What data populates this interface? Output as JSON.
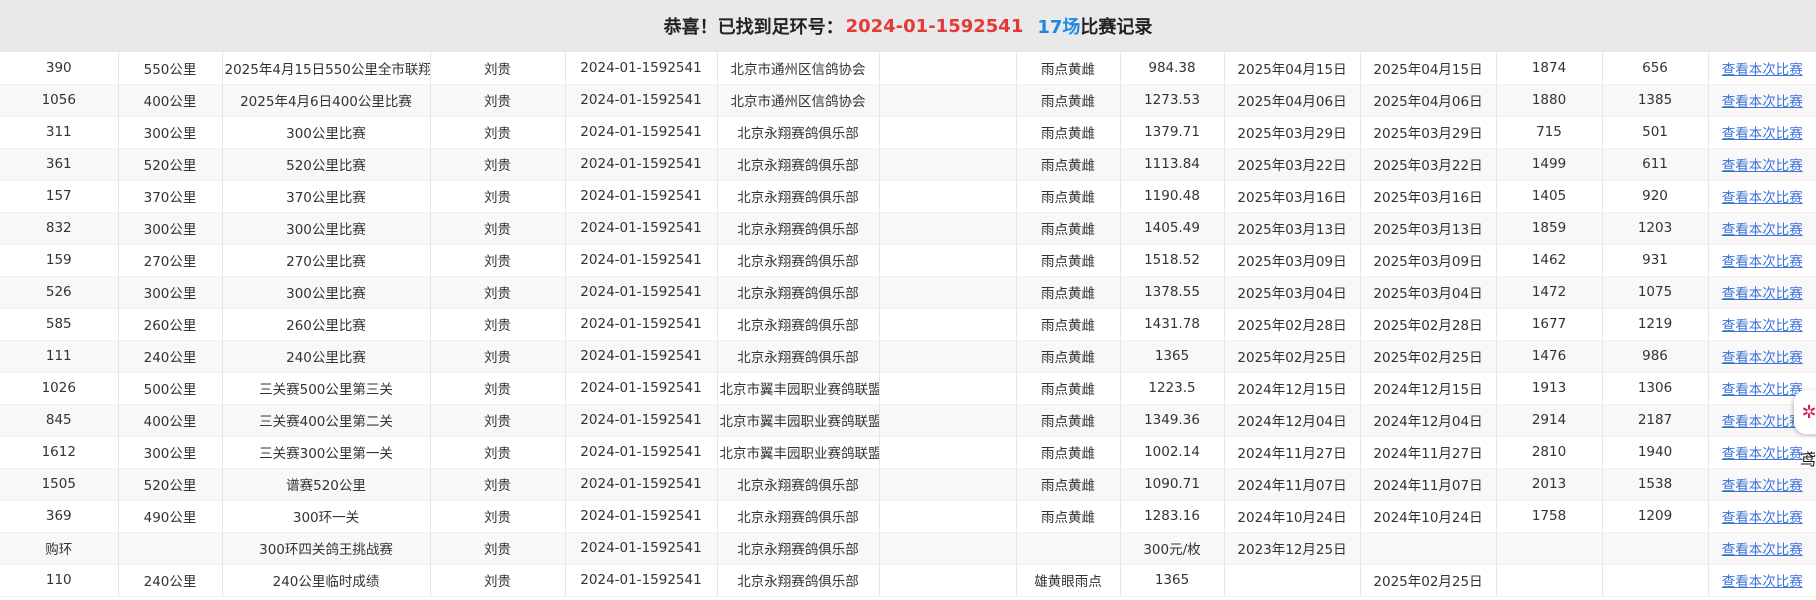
{
  "header": {
    "prefix": "恭喜！已找到足环号：",
    "ring_number": "2024-01-1592541",
    "count": "17场",
    "suffix": "比赛记录"
  },
  "rows": [
    {
      "rank": "390",
      "distance": "550公里",
      "race": "2025年4月15日550公里全市联翔",
      "owner": "刘贵",
      "ring": "2024-01-1592541",
      "org": "北京市通州区信鸽协会",
      "extra": "",
      "feather": "雨点黄雌",
      "speed": "984.38",
      "date1": "2025年04月15日",
      "date2": "2025年04月15日",
      "total": "1874",
      "basket": "656",
      "link": "查看本次比赛"
    },
    {
      "rank": "1056",
      "distance": "400公里",
      "race": "2025年4月6日400公里比赛",
      "owner": "刘贵",
      "ring": "2024-01-1592541",
      "org": "北京市通州区信鸽协会",
      "extra": "",
      "feather": "雨点黄雌",
      "speed": "1273.53",
      "date1": "2025年04月06日",
      "date2": "2025年04月06日",
      "total": "1880",
      "basket": "1385",
      "link": "查看本次比赛"
    },
    {
      "rank": "311",
      "distance": "300公里",
      "race": "300公里比赛",
      "owner": "刘贵",
      "ring": "2024-01-1592541",
      "org": "北京永翔赛鸽俱乐部",
      "extra": "",
      "feather": "雨点黄雌",
      "speed": "1379.71",
      "date1": "2025年03月29日",
      "date2": "2025年03月29日",
      "total": "715",
      "basket": "501",
      "link": "查看本次比赛"
    },
    {
      "rank": "361",
      "distance": "520公里",
      "race": "520公里比赛",
      "owner": "刘贵",
      "ring": "2024-01-1592541",
      "org": "北京永翔赛鸽俱乐部",
      "extra": "",
      "feather": "雨点黄雌",
      "speed": "1113.84",
      "date1": "2025年03月22日",
      "date2": "2025年03月22日",
      "total": "1499",
      "basket": "611",
      "link": "查看本次比赛"
    },
    {
      "rank": "157",
      "distance": "370公里",
      "race": "370公里比赛",
      "owner": "刘贵",
      "ring": "2024-01-1592541",
      "org": "北京永翔赛鸽俱乐部",
      "extra": "",
      "feather": "雨点黄雌",
      "speed": "1190.48",
      "date1": "2025年03月16日",
      "date2": "2025年03月16日",
      "total": "1405",
      "basket": "920",
      "link": "查看本次比赛"
    },
    {
      "rank": "832",
      "distance": "300公里",
      "race": "300公里比赛",
      "owner": "刘贵",
      "ring": "2024-01-1592541",
      "org": "北京永翔赛鸽俱乐部",
      "extra": "",
      "feather": "雨点黄雌",
      "speed": "1405.49",
      "date1": "2025年03月13日",
      "date2": "2025年03月13日",
      "total": "1859",
      "basket": "1203",
      "link": "查看本次比赛"
    },
    {
      "rank": "159",
      "distance": "270公里",
      "race": "270公里比赛",
      "owner": "刘贵",
      "ring": "2024-01-1592541",
      "org": "北京永翔赛鸽俱乐部",
      "extra": "",
      "feather": "雨点黄雌",
      "speed": "1518.52",
      "date1": "2025年03月09日",
      "date2": "2025年03月09日",
      "total": "1462",
      "basket": "931",
      "link": "查看本次比赛"
    },
    {
      "rank": "526",
      "distance": "300公里",
      "race": "300公里比赛",
      "owner": "刘贵",
      "ring": "2024-01-1592541",
      "org": "北京永翔赛鸽俱乐部",
      "extra": "",
      "feather": "雨点黄雌",
      "speed": "1378.55",
      "date1": "2025年03月04日",
      "date2": "2025年03月04日",
      "total": "1472",
      "basket": "1075",
      "link": "查看本次比赛"
    },
    {
      "rank": "585",
      "distance": "260公里",
      "race": "260公里比赛",
      "owner": "刘贵",
      "ring": "2024-01-1592541",
      "org": "北京永翔赛鸽俱乐部",
      "extra": "",
      "feather": "雨点黄雌",
      "speed": "1431.78",
      "date1": "2025年02月28日",
      "date2": "2025年02月28日",
      "total": "1677",
      "basket": "1219",
      "link": "查看本次比赛"
    },
    {
      "rank": "111",
      "distance": "240公里",
      "race": "240公里比赛",
      "owner": "刘贵",
      "ring": "2024-01-1592541",
      "org": "北京永翔赛鸽俱乐部",
      "extra": "",
      "feather": "雨点黄雌",
      "speed": "1365",
      "date1": "2025年02月25日",
      "date2": "2025年02月25日",
      "total": "1476",
      "basket": "986",
      "link": "查看本次比赛"
    },
    {
      "rank": "1026",
      "distance": "500公里",
      "race": "三关赛500公里第三关",
      "owner": "刘贵",
      "ring": "2024-01-1592541",
      "org": "北京市翼丰园职业赛鸽联盟",
      "extra": "",
      "feather": "雨点黄雌",
      "speed": "1223.5",
      "date1": "2024年12月15日",
      "date2": "2024年12月15日",
      "total": "1913",
      "basket": "1306",
      "link": "查看本次比赛"
    },
    {
      "rank": "845",
      "distance": "400公里",
      "race": "三关赛400公里第二关",
      "owner": "刘贵",
      "ring": "2024-01-1592541",
      "org": "北京市翼丰园职业赛鸽联盟",
      "extra": "",
      "feather": "雨点黄雌",
      "speed": "1349.36",
      "date1": "2024年12月04日",
      "date2": "2024年12月04日",
      "total": "2914",
      "basket": "2187",
      "link": "查看本次比赛"
    },
    {
      "rank": "1612",
      "distance": "300公里",
      "race": "三关赛300公里第一关",
      "owner": "刘贵",
      "ring": "2024-01-1592541",
      "org": "北京市翼丰园职业赛鸽联盟",
      "extra": "",
      "feather": "雨点黄雌",
      "speed": "1002.14",
      "date1": "2024年11月27日",
      "date2": "2024年11月27日",
      "total": "2810",
      "basket": "1940",
      "link": "查看本次比赛"
    },
    {
      "rank": "1505",
      "distance": "520公里",
      "race": "谱赛520公里",
      "owner": "刘贵",
      "ring": "2024-01-1592541",
      "org": "北京永翔赛鸽俱乐部",
      "extra": "",
      "feather": "雨点黄雌",
      "speed": "1090.71",
      "date1": "2024年11月07日",
      "date2": "2024年11月07日",
      "total": "2013",
      "basket": "1538",
      "link": "查看本次比赛"
    },
    {
      "rank": "369",
      "distance": "490公里",
      "race": "300环一关",
      "owner": "刘贵",
      "ring": "2024-01-1592541",
      "org": "北京永翔赛鸽俱乐部",
      "extra": "",
      "feather": "雨点黄雌",
      "speed": "1283.16",
      "date1": "2024年10月24日",
      "date2": "2024年10月24日",
      "total": "1758",
      "basket": "1209",
      "link": "查看本次比赛"
    },
    {
      "rank": "购环",
      "distance": "",
      "race": "300环四关鸽王挑战赛",
      "owner": "刘贵",
      "ring": "2024-01-1592541",
      "org": "北京永翔赛鸽俱乐部",
      "extra": "",
      "feather": "",
      "speed": "300元/枚",
      "date1": "2023年12月25日",
      "date2": "",
      "total": "",
      "basket": "",
      "link": "查看本次比赛"
    },
    {
      "rank": "110",
      "distance": "240公里",
      "race": "240公里临时成绩",
      "owner": "刘贵",
      "ring": "2024-01-1592541",
      "org": "北京永翔赛鸽俱乐部",
      "extra": "",
      "feather": "雄黄眼雨点",
      "speed": "1365",
      "date1": "",
      "date2": "2025年02月25日",
      "total": "",
      "basket": "",
      "link": "查看本次比赛"
    }
  ],
  "float_widget": {
    "icon": "app-icon",
    "text": "鸢"
  },
  "colors": {
    "header_bg": "#e9e9e9",
    "ring_number": "#e53935",
    "count": "#1e88e5",
    "link": "#3b73d9"
  }
}
